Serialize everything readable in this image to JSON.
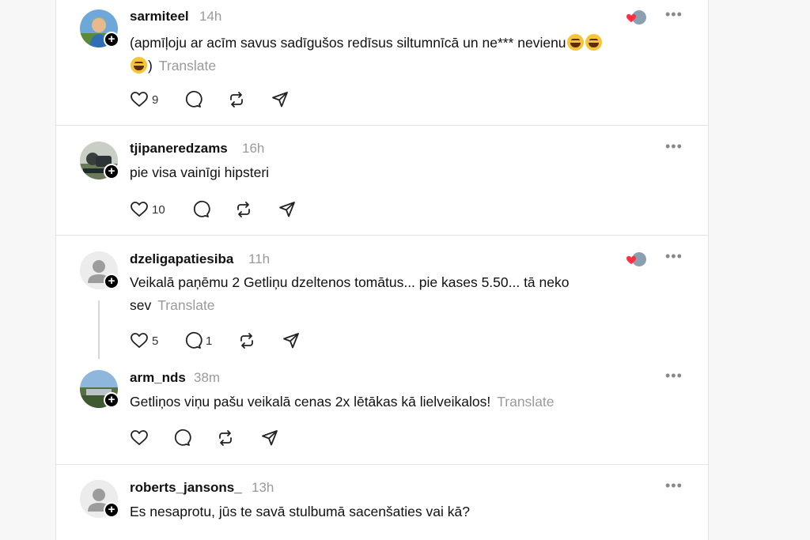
{
  "posts": [
    {
      "username": "sarmiteel",
      "time": "14h",
      "text": "(apmīļoju ar acīm savus sadīgušos redīsus siltumnīcā un ne*** nevienu",
      "text_tail": ")",
      "translate": "Translate",
      "likes": "9",
      "replies": "",
      "avatar_color": "#f0b400"
    },
    {
      "username": "tjipaneredzams",
      "time": "16h",
      "text": "pie visa vainīgi hipsteri",
      "likes": "10",
      "replies": "",
      "avatar_color": "#4a5a4c"
    },
    {
      "username": "dzeligapatiesiba",
      "time": "11h",
      "text": "Veikalā paņēmu 2 Getliņu dzeltenos tomātus... pie kases 5.50... tā neko sev",
      "translate": "Translate",
      "likes": "5",
      "replies": "1",
      "avatar_color": "#9a9a9a"
    },
    {
      "username": "arm_nds",
      "time": "38m",
      "text": "Getliņos viņu pašu veikalā cenas 2x lētākas kā lielveikalos!",
      "translate": "Translate",
      "likes": "",
      "replies": "",
      "avatar_color": "#7fa4c8"
    },
    {
      "username": "roberts_jansons_",
      "time": "13h",
      "text": "Es nesaprotu, jūs te savā stulbumā sacenšaties vai kā?",
      "likes": "",
      "replies": "",
      "avatar_color": "#9a9a9a"
    }
  ],
  "icons": {
    "more": "more-options-icon",
    "like": "heart-icon",
    "reply": "reply-bubble-icon",
    "repost": "repost-icon",
    "share": "send-icon",
    "follow": "plus-icon"
  },
  "colors": {
    "accent_heart": "#ff3040",
    "muted_text": "#9a9a9a",
    "divider": "#e4e4e4"
  }
}
